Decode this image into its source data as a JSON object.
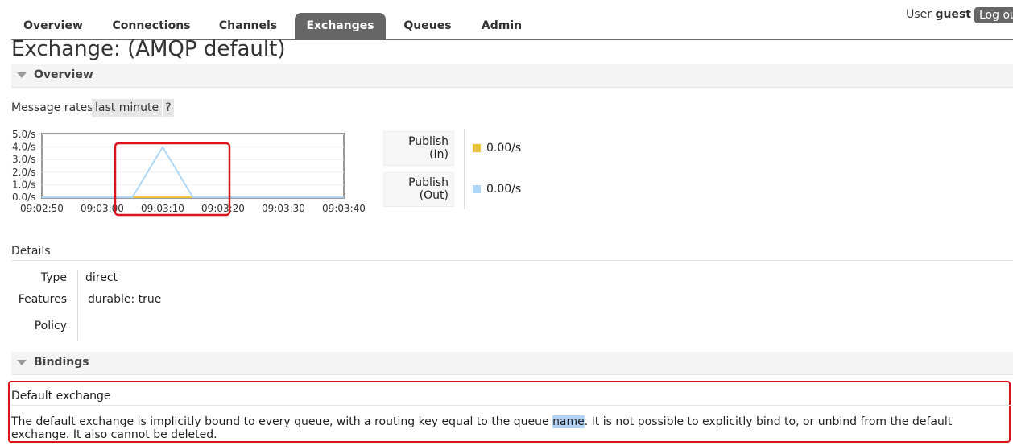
{
  "nav": {
    "tabs": [
      {
        "label": "Overview"
      },
      {
        "label": "Connections"
      },
      {
        "label": "Channels"
      },
      {
        "label": "Exchanges",
        "active": true
      },
      {
        "label": "Queues"
      },
      {
        "label": "Admin"
      }
    ],
    "user_prefix": "User",
    "user_name": "guest",
    "logout_label": "Log out"
  },
  "page": {
    "title": "Exchange: (AMQP default)"
  },
  "overview": {
    "section_label": "Overview",
    "rates_label": "Message rates",
    "rates_range": "last minute",
    "help_label": "?"
  },
  "chart_data": {
    "type": "line",
    "x": [
      "09:02:50",
      "09:02:55",
      "09:03:00",
      "09:03:05",
      "09:03:10",
      "09:03:15",
      "09:03:20",
      "09:03:25",
      "09:03:30",
      "09:03:35",
      "09:03:40"
    ],
    "xticks": [
      "09:02:50",
      "09:03:00",
      "09:03:10",
      "09:03:20",
      "09:03:30",
      "09:03:40"
    ],
    "yticks": [
      "5.0/s",
      "4.0/s",
      "3.0/s",
      "2.0/s",
      "1.0/s",
      "0.0/s"
    ],
    "ylim": [
      0,
      5
    ],
    "series": [
      {
        "name": "Publish (In)",
        "color": "#edc240",
        "values": [
          0,
          0,
          0,
          0,
          0,
          0,
          0,
          0,
          0,
          0,
          0
        ]
      },
      {
        "name": "Publish (Out)",
        "color": "#afd8f8",
        "values": [
          0,
          0,
          0,
          0,
          4,
          0,
          0,
          0,
          0,
          0,
          0
        ]
      }
    ],
    "highlight_color": "#d9141b"
  },
  "legend": [
    {
      "label_line1": "Publish",
      "label_line2": "(In)",
      "rate": "0.00/s",
      "color": "#edc240"
    },
    {
      "label_line1": "Publish",
      "label_line2": "(Out)",
      "rate": "0.00/s",
      "color": "#afd8f8"
    }
  ],
  "details": {
    "section_label": "Details",
    "type_key": "Type",
    "type_value": "direct",
    "features_key": "Features",
    "features_name": "durable:",
    "features_value": "true",
    "policy_key": "Policy",
    "policy_value": ""
  },
  "bindings": {
    "section_label": "Bindings",
    "default_title": "Default exchange",
    "text_before": "The default exchange is implicitly bound to every queue, with a routing key equal to the queue ",
    "text_highlight": "name",
    "text_after": ". It is not possible to explicitly bind to, or unbind from the default exchange. It also cannot be deleted."
  }
}
